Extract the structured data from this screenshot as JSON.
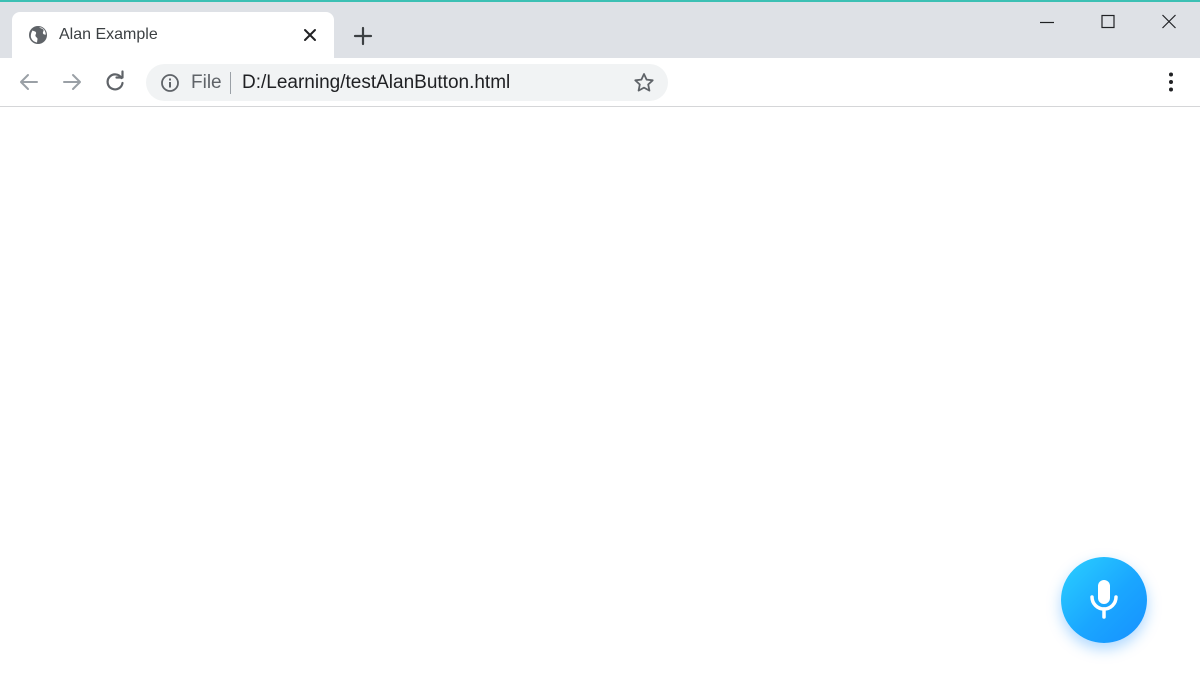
{
  "browser": {
    "tab": {
      "title": "Alan Example",
      "favicon": "globe-icon"
    },
    "new_tab_icon": "plus-icon",
    "window_controls": [
      "minimize-icon",
      "maximize-icon",
      "close-icon"
    ],
    "toolbar": {
      "back_icon": "arrow-left-icon",
      "forward_icon": "arrow-right-icon",
      "reload_icon": "reload-icon",
      "omnibox": {
        "security_icon": "info-icon",
        "scheme_label": "File",
        "url": "D:/Learning/testAlanButton.html",
        "bookmark_icon": "star-icon"
      },
      "menu_icon": "kebab-menu-icon"
    }
  },
  "page": {
    "alan_button": {
      "icon": "microphone-icon",
      "colors": {
        "start": "#2bd0ff",
        "end": "#1690ff"
      }
    }
  },
  "colors": {
    "tabstrip": "#dee1e6",
    "omnibox": "#f1f3f4",
    "accent_line": "#3cc0b4"
  }
}
